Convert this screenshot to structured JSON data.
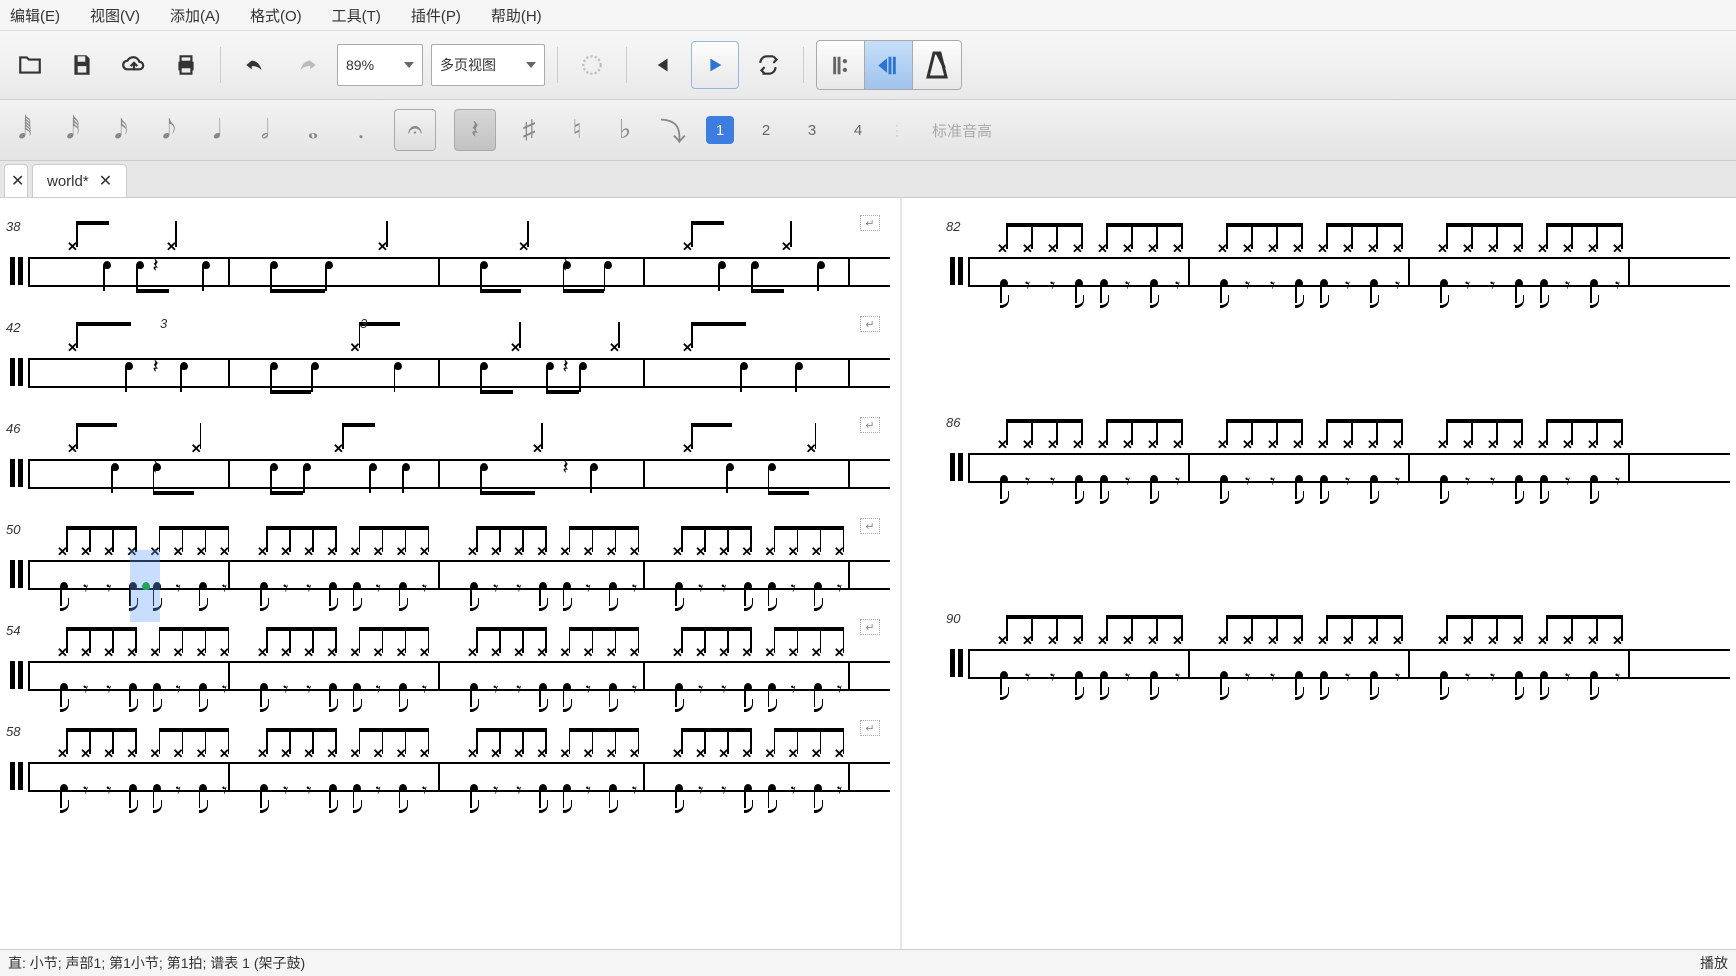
{
  "menus": {
    "edit": "编辑(E)",
    "view": "视图(V)",
    "add": "添加(A)",
    "format": "格式(O)",
    "tools": "工具(T)",
    "plugins": "插件(P)",
    "help": "帮助(H)"
  },
  "toolbar": {
    "zoom": "89%",
    "layout": "多页视图"
  },
  "voices": {
    "v1": "1",
    "v2": "2",
    "v3": "3",
    "v4": "4"
  },
  "pitch_label": "标准音高",
  "tabs": {
    "doc": "world*"
  },
  "status": {
    "left": "直: 小节;  声部1;   第1小节;  第1拍;  谱表 1 (架子鼓)",
    "right": "播放"
  },
  "left_systems": [
    38,
    42,
    46,
    50,
    54,
    58
  ],
  "right_systems": [
    82,
    86,
    90
  ],
  "left_bars": [
    0,
    200,
    410,
    615,
    820
  ],
  "right_bars": [
    0,
    220,
    440,
    660
  ]
}
